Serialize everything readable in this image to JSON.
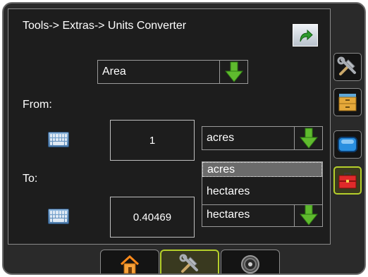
{
  "breadcrumb": "Tools-> Extras-> Units Converter",
  "category": {
    "value": "Area"
  },
  "from": {
    "label": "From:",
    "value": "1",
    "unit": "acres"
  },
  "to": {
    "label": "To:",
    "value": "0.40469",
    "unit": "hectares"
  },
  "unit_dropdown": {
    "options": [
      "acres",
      "hectares"
    ],
    "highlighted": "acres"
  },
  "sidebar": {
    "items": [
      {
        "icon": "tools-icon",
        "active": false
      },
      {
        "icon": "file-cabinet-icon",
        "active": false
      },
      {
        "icon": "display-icon",
        "active": false
      },
      {
        "icon": "toolbox-icon",
        "active": true
      }
    ]
  },
  "bottom_tabs": [
    {
      "icon": "home-icon",
      "active": false
    },
    {
      "icon": "tools-icon",
      "active": true
    },
    {
      "icon": "gauge-icon",
      "active": false
    }
  ],
  "colors": {
    "accent": "#b5cf2b",
    "arrow_green": "#5fba2e",
    "background": "#1d1d1d"
  }
}
